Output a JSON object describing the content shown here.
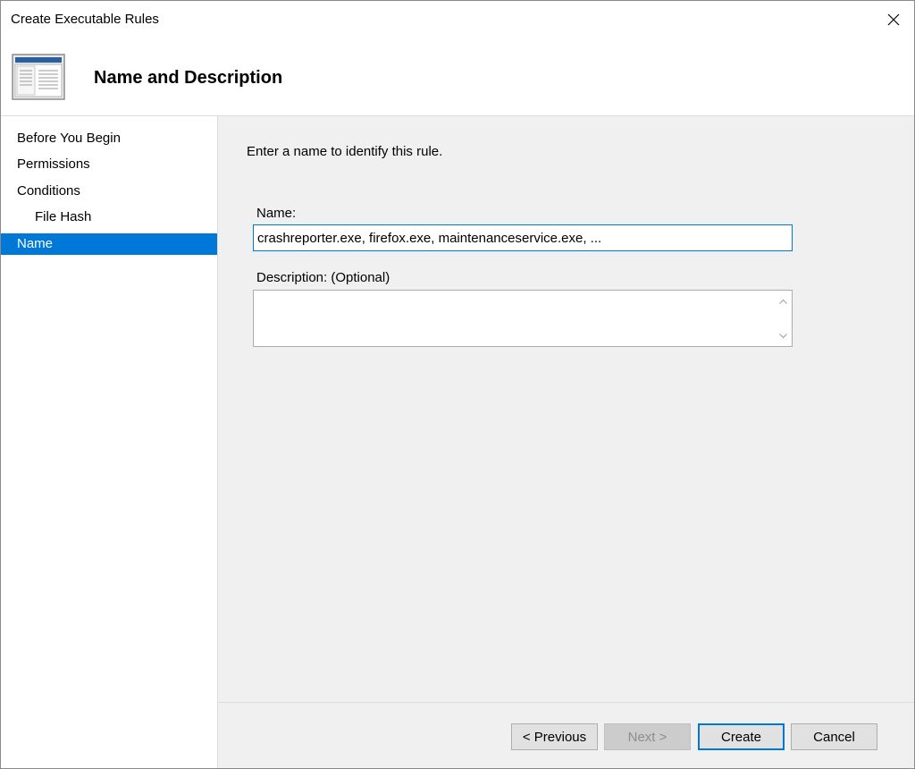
{
  "window": {
    "title": "Create Executable Rules"
  },
  "header": {
    "heading": "Name and Description"
  },
  "sidebar": {
    "steps": [
      {
        "label": "Before You Begin"
      },
      {
        "label": "Permissions"
      },
      {
        "label": "Conditions"
      },
      {
        "label": "File Hash"
      },
      {
        "label": "Name"
      }
    ]
  },
  "content": {
    "intro": "Enter a name to identify this rule.",
    "name_label": "Name:",
    "name_value": "crashreporter.exe, firefox.exe, maintenanceservice.exe, ...",
    "description_label": "Description: (Optional)",
    "description_value": ""
  },
  "buttons": {
    "previous": "< Previous",
    "next": "Next >",
    "create": "Create",
    "cancel": "Cancel"
  },
  "colors": {
    "accent": "#0078d7",
    "panel": "#f0f0f0",
    "button_face": "#e1e1e1"
  }
}
